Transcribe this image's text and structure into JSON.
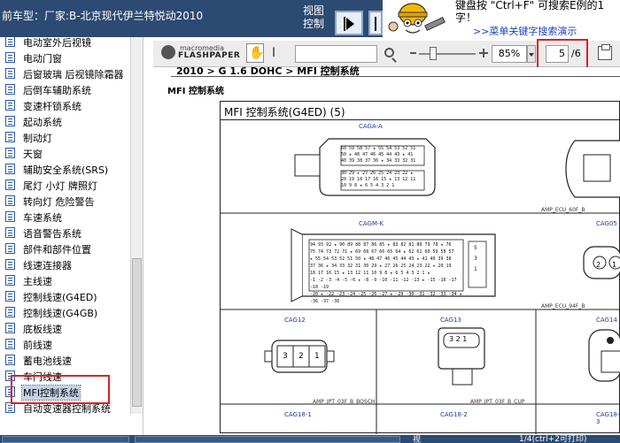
{
  "header": {
    "title": "前车型：厂家:B-北京现代伊兰特悦动2010",
    "view_control_line1": "视图",
    "view_control_line2": "控制",
    "hint_line1": "键盘按 \"Ctrl+F\" 可搜索E例的1",
    "hint_line2": "字！",
    "hint_link": ">>菜单关键字搜索演示"
  },
  "sidebar": {
    "items": [
      {
        "label": "电动室外后视镜"
      },
      {
        "label": "电动门窗"
      },
      {
        "label": "后窗玻璃 后视镜除霜器"
      },
      {
        "label": "后倒车辅助系统"
      },
      {
        "label": "变速杆锁系统"
      },
      {
        "label": "起动系统"
      },
      {
        "label": "制动灯"
      },
      {
        "label": "天窗"
      },
      {
        "label": "辅助安全系统(SRS)"
      },
      {
        "label": "尾灯 小灯 牌照灯"
      },
      {
        "label": "转向灯 危险警告"
      },
      {
        "label": "车速系统"
      },
      {
        "label": "语音警告系统"
      },
      {
        "label": "部件和部件位置"
      },
      {
        "label": "线速连接器"
      },
      {
        "label": "主线速"
      },
      {
        "label": "控制线速(G4ED)"
      },
      {
        "label": "控制线速(G4GB)"
      },
      {
        "label": "底板线速"
      },
      {
        "label": "前线速"
      },
      {
        "label": "蓄电池线速"
      },
      {
        "label": "车门线速"
      },
      {
        "label": "MFI控制系统"
      },
      {
        "label": "自动变速器控制系统"
      }
    ],
    "selected_index": 22
  },
  "toolbar": {
    "logo_line1": "macromedia",
    "logo_line2": "FLASHPAPER",
    "search_value": "",
    "zoom_value": "85%",
    "page_value": "5",
    "page_total": "/6"
  },
  "document": {
    "path": "2010 > G 1.6 DOHC > MFI 控制系统",
    "section": "MFI 控制系统",
    "diagram_title": "MFI 控制系统(G4ED) (5)",
    "connectors": {
      "caga": "CAGA-A",
      "cagm": "CAGM-K",
      "cag05": "CAG05",
      "cag12": "CAG12",
      "cag13": "CAG13",
      "cag14": "CAG14",
      "cag18_1": "CAG18-1",
      "cag18_2": "CAG18-2",
      "cag18_3": "CAG18-3"
    },
    "parts": {
      "ecu_60": "AMP_ECU_60F_B",
      "ecu_94": "AMP_ECU_94F_B",
      "jpt_bosch": "AMP_JPT_03F_B_BOSCH",
      "jpt_cup": "AMP_JPT_03F_B_CUP"
    }
  },
  "statusbar": {
    "view_mini": "视",
    "page_text": "1/4(ctrl+2可打印)"
  },
  "colors": {
    "title_bar": "#2c4a72",
    "highlight_box": "#e02020",
    "connector_label": "#1c3c9c"
  }
}
